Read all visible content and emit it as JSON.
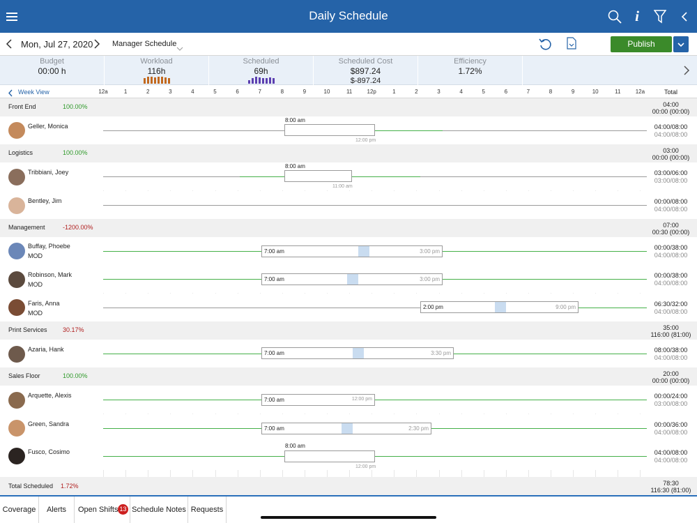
{
  "header": {
    "title": "Daily Schedule"
  },
  "subbar": {
    "date": "Mon, Jul 27, 2020",
    "schedule": "Manager Schedule",
    "publish": "Publish"
  },
  "metrics": [
    {
      "label": "Budget",
      "value": "00:00 h"
    },
    {
      "label": "Workload",
      "value": "116h"
    },
    {
      "label": "Scheduled",
      "value": "69h"
    },
    {
      "label": "Scheduled Cost",
      "value": "$897.24",
      "value2": "$-897.24"
    },
    {
      "label": "Efficiency",
      "value": "1.72%"
    }
  ],
  "timeline": {
    "week_view": "Week View",
    "ticks": [
      "12a",
      "1",
      "2",
      "3",
      "4",
      "5",
      "6",
      "7",
      "8",
      "9",
      "10",
      "11",
      "12p",
      "1",
      "2",
      "3",
      "4",
      "5",
      "6",
      "7",
      "8",
      "9",
      "10",
      "11",
      "12a"
    ],
    "total_label": "Total"
  },
  "groups": {
    "front_end": {
      "name": "Front End",
      "pct": "100.00%",
      "total_a": "04:00",
      "total_b": "00:00 (00:00)"
    },
    "logistics": {
      "name": "Logistics",
      "pct": "100.00%",
      "total_a": "03:00",
      "total_b": "00:00 (00:00)"
    },
    "management": {
      "name": "Management",
      "pct": "-1200.00%",
      "total_a": "07:00",
      "total_b": "00:30 (00:00)"
    },
    "print": {
      "name": "Print Services",
      "pct": "30.17%",
      "total_a": "35:00",
      "total_b": "116:00 (81:00)"
    },
    "sales": {
      "name": "Sales Floor",
      "pct": "100.00%",
      "total_a": "20:00",
      "total_b": "00:00 (00:00)"
    }
  },
  "employees": {
    "geller": {
      "name": "Geller, Monica",
      "t1": "04:00/08:00",
      "t2": "04:00/08:00",
      "start": "8:00 am",
      "end": "12:00 pm"
    },
    "tribbiani": {
      "name": "Tribbiani, Joey",
      "t1": "03:00/06:00",
      "t2": "03:00/08:00",
      "start": "8:00 am",
      "end": "11:00 am"
    },
    "bentley": {
      "name": "Bentley, Jim",
      "t1": "00:00/08:00",
      "t2": "04:00/08:00"
    },
    "buffay": {
      "name": "Buffay, Phoebe",
      "sub": "MOD",
      "t1": "00:00/38:00",
      "t2": "04:00/08:00",
      "start": "7:00 am",
      "end": "3:00 pm"
    },
    "robinson": {
      "name": "Robinson, Mark",
      "sub": "MOD",
      "t1": "00:00/38:00",
      "t2": "04:00/08:00",
      "start": "7:00 am",
      "end": "3:00 pm"
    },
    "faris": {
      "name": "Faris, Anna",
      "sub": "MOD",
      "t1": "06:30/32:00",
      "t2": "04:00/08:00",
      "start": "2:00 pm",
      "end": "9:00 pm"
    },
    "azaria": {
      "name": "Azaria, Hank",
      "t1": "08:00/38:00",
      "t2": "04:00/08:00",
      "start": "7:00 am",
      "end": "3:30 pm"
    },
    "arquette": {
      "name": "Arquette, Alexis",
      "t1": "00:00/24:00",
      "t2": "03:00/08:00",
      "start": "7:00 am",
      "end": "12:00 pm"
    },
    "green": {
      "name": "Green, Sandra",
      "t1": "00:00/36:00",
      "t2": "04:00/08:00",
      "start": "7:00 am",
      "end": "2:30 pm"
    },
    "fusco": {
      "name": "Fusco, Cosimo",
      "t1": "04:00/08:00",
      "t2": "04:00/08:00",
      "start": "8:00 am",
      "end": "12:00 pm"
    }
  },
  "total_scheduled": {
    "label": "Total Scheduled",
    "pct": "1.72%",
    "a": "78:30",
    "b": "116:30 (81:00)"
  },
  "footer": {
    "tabs": [
      "Coverage",
      "Alerts",
      "Open Shifts",
      "Schedule Notes",
      "Requests"
    ],
    "badge": "13"
  },
  "icons": [
    "menu-icon",
    "search-icon",
    "info-icon",
    "filter-icon",
    "back-icon",
    "prev-date-icon",
    "next-date-icon",
    "dropdown-icon",
    "refresh-icon",
    "document-icon",
    "chevron-right-icon",
    "week-view-back-icon"
  ],
  "colors": {
    "header": "#2563a8",
    "publish": "#3b8a2a",
    "green": "#44b048",
    "red": "#b01e1e"
  }
}
